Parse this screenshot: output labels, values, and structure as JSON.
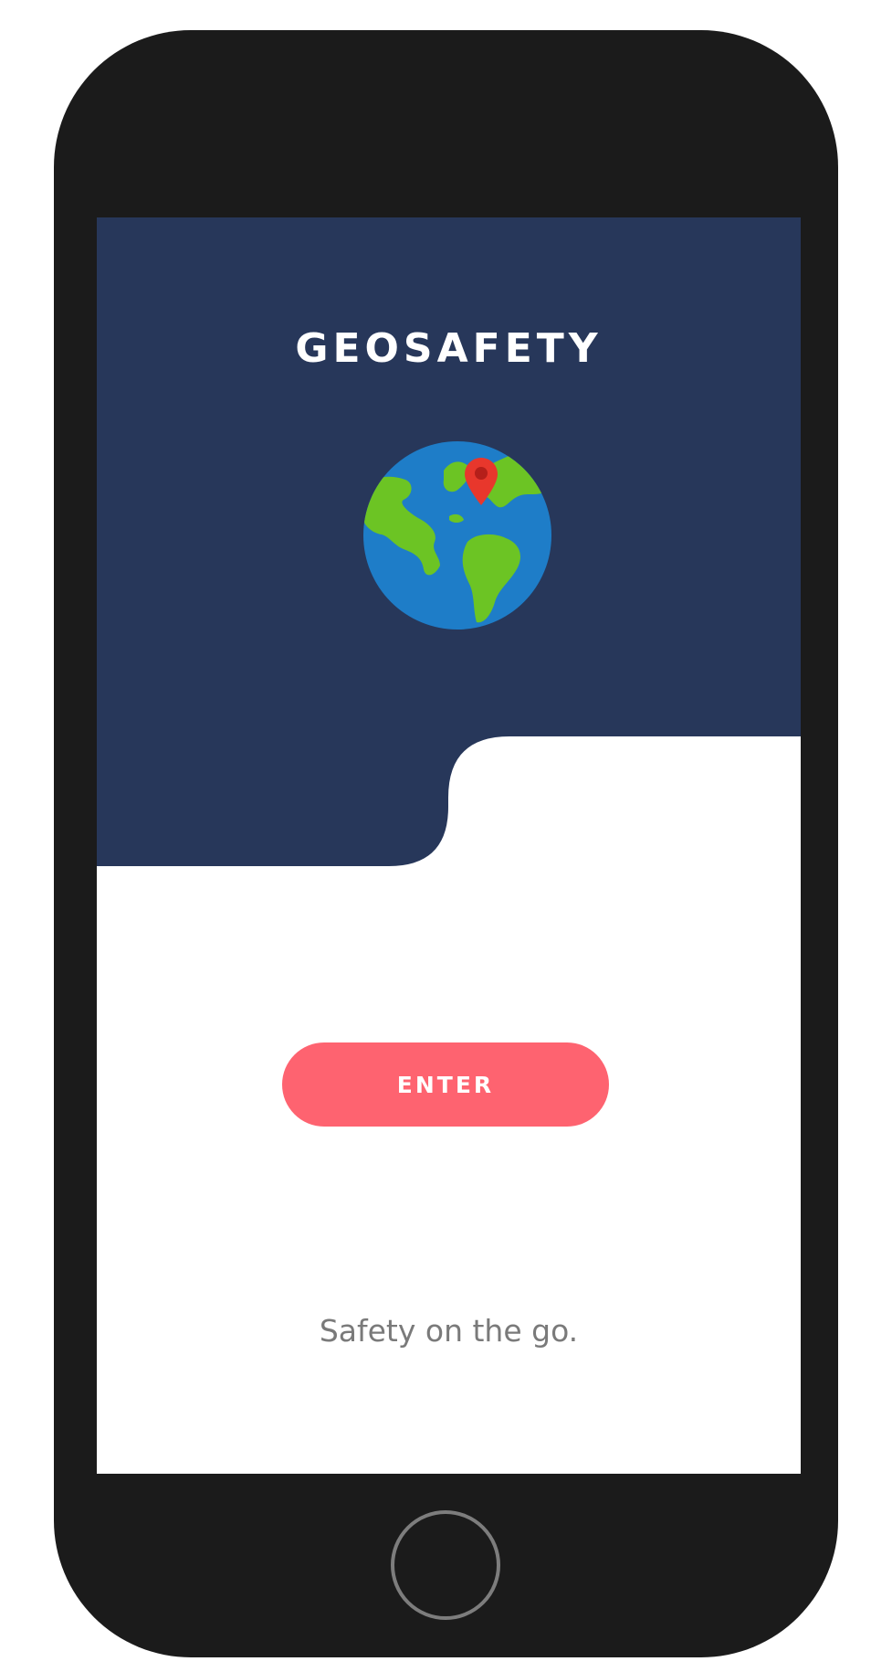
{
  "app": {
    "title": "GEOSAFETY",
    "logo_icon": "globe-with-map-pin-icon"
  },
  "main": {
    "enter_label": "ENTER",
    "tagline": "Safety on the go."
  },
  "device": {
    "home_button_icon": "home-button"
  },
  "colors": {
    "header_background": "#27375a",
    "accent_button": "#fe6370",
    "device_frame": "#1b1b1b",
    "tagline_text": "#7a7a7a",
    "globe_ocean": "#1e7dc8",
    "globe_land": "#6cc424",
    "map_pin": "#e8372c"
  }
}
